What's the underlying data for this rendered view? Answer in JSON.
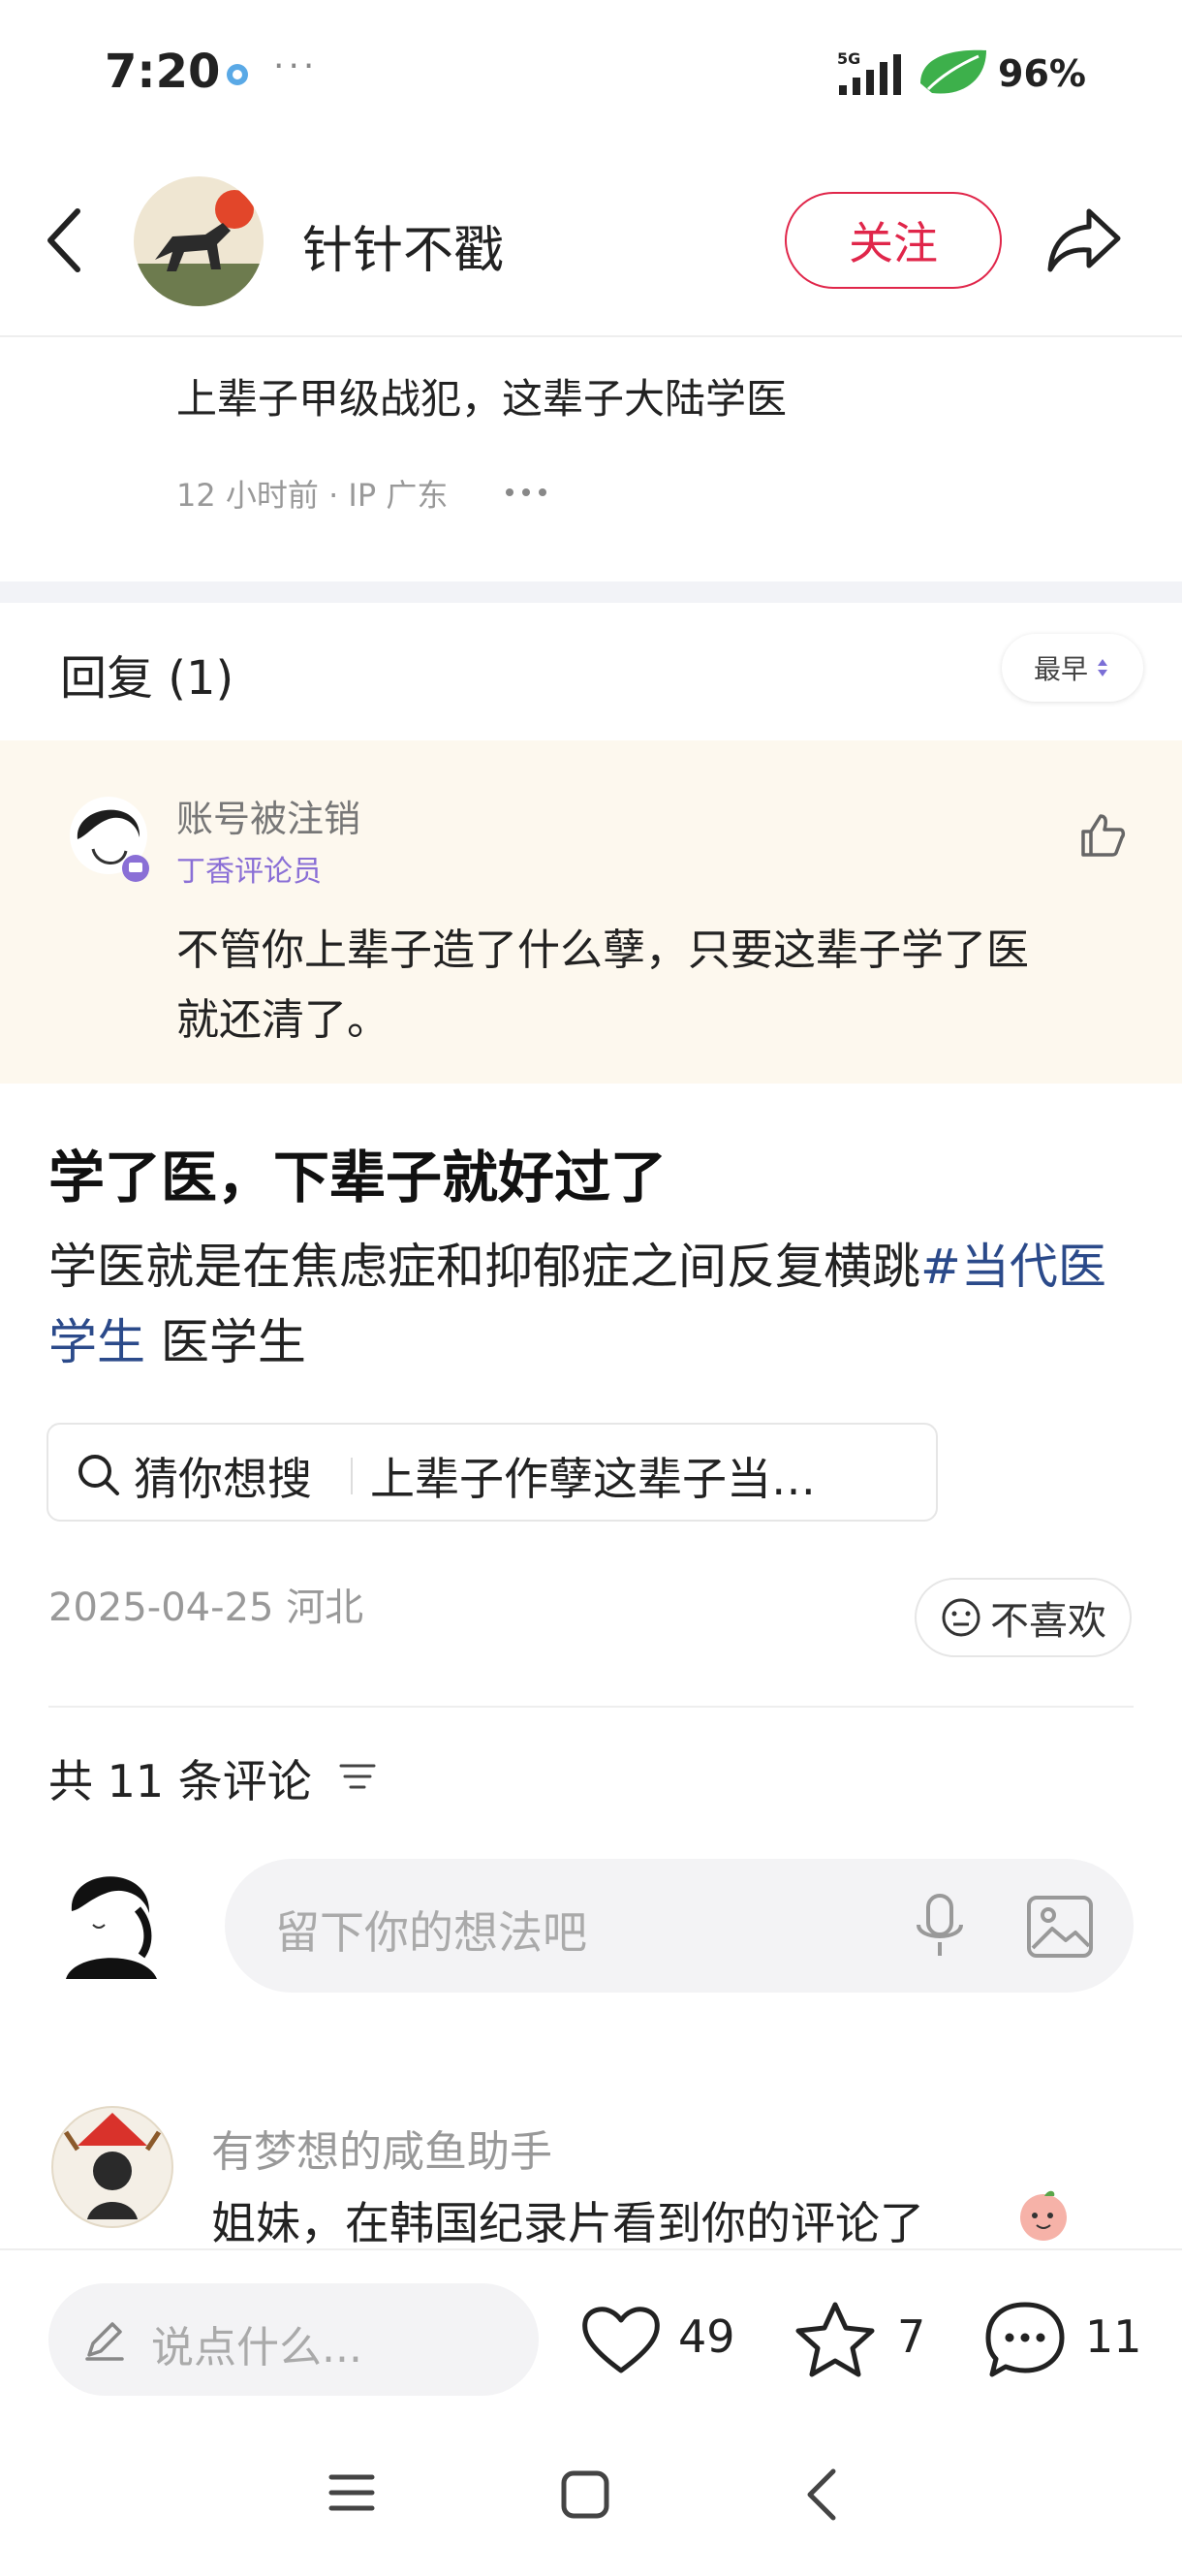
{
  "status_bar": {
    "time": "7:20",
    "dots": "···",
    "network": "5G",
    "battery": "96%"
  },
  "header": {
    "username": "针针不戳",
    "follow_label": "关注",
    "icons": [
      "back-arrow-icon",
      "share-icon"
    ]
  },
  "parent_comment": {
    "text": "上辈子甲级战犯，这辈子大陆学医",
    "time": "12 小时前",
    "ip": "IP 广东"
  },
  "replies": {
    "title": "回复 (1)",
    "sort_label": "最早",
    "items": [
      {
        "author": "账号被注销",
        "badge": "丁香评论员",
        "text_line1": "不管你上辈子造了什么孽，只要这辈子学了医",
        "text_line2": "就还清了。"
      }
    ]
  },
  "post": {
    "title": "学了医，下辈子就好过了",
    "body_text": "学医就是在焦虑症和抑郁症之间反复横跳",
    "hashtag": "#当代医学生",
    "tag_plain": "医学生",
    "search_hint": "猜你想搜",
    "search_query": "上辈子作孽这辈子当…",
    "date": "2025-04-25",
    "location": "河北",
    "dislike_label": "不喜欢"
  },
  "comments": {
    "count_label": "共 11 条评论",
    "input_placeholder": "留下你的想法吧",
    "items": [
      {
        "author": "有梦想的咸鱼助手",
        "text": "姐妹，在韩国纪录片看到你的评论了"
      }
    ]
  },
  "bottom_bar": {
    "say_placeholder": "说点什么...",
    "likes": "49",
    "stars": "7",
    "comments": "11"
  },
  "colors": {
    "accent_red": "#e0264a",
    "hashtag_blue": "#2b4a8a",
    "reply_bg": "#fdf8ee",
    "badge_purple": "#8a6fd6"
  }
}
